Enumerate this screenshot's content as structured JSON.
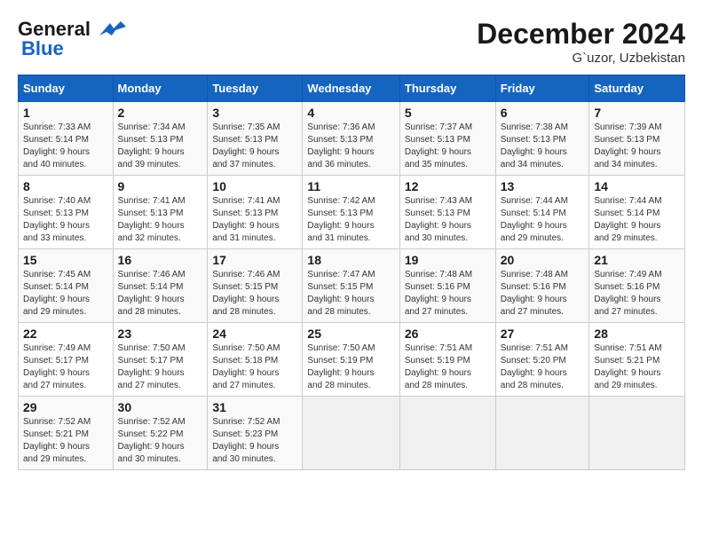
{
  "header": {
    "logo_line1": "General",
    "logo_line2": "Blue",
    "month_title": "December 2024",
    "subtitle": "G`uzor, Uzbekistan"
  },
  "weekdays": [
    "Sunday",
    "Monday",
    "Tuesday",
    "Wednesday",
    "Thursday",
    "Friday",
    "Saturday"
  ],
  "weeks": [
    [
      {
        "day": "1",
        "info": "Sunrise: 7:33 AM\nSunset: 5:14 PM\nDaylight: 9 hours\nand 40 minutes."
      },
      {
        "day": "2",
        "info": "Sunrise: 7:34 AM\nSunset: 5:13 PM\nDaylight: 9 hours\nand 39 minutes."
      },
      {
        "day": "3",
        "info": "Sunrise: 7:35 AM\nSunset: 5:13 PM\nDaylight: 9 hours\nand 37 minutes."
      },
      {
        "day": "4",
        "info": "Sunrise: 7:36 AM\nSunset: 5:13 PM\nDaylight: 9 hours\nand 36 minutes."
      },
      {
        "day": "5",
        "info": "Sunrise: 7:37 AM\nSunset: 5:13 PM\nDaylight: 9 hours\nand 35 minutes."
      },
      {
        "day": "6",
        "info": "Sunrise: 7:38 AM\nSunset: 5:13 PM\nDaylight: 9 hours\nand 34 minutes."
      },
      {
        "day": "7",
        "info": "Sunrise: 7:39 AM\nSunset: 5:13 PM\nDaylight: 9 hours\nand 34 minutes."
      }
    ],
    [
      {
        "day": "8",
        "info": "Sunrise: 7:40 AM\nSunset: 5:13 PM\nDaylight: 9 hours\nand 33 minutes."
      },
      {
        "day": "9",
        "info": "Sunrise: 7:41 AM\nSunset: 5:13 PM\nDaylight: 9 hours\nand 32 minutes."
      },
      {
        "day": "10",
        "info": "Sunrise: 7:41 AM\nSunset: 5:13 PM\nDaylight: 9 hours\nand 31 minutes."
      },
      {
        "day": "11",
        "info": "Sunrise: 7:42 AM\nSunset: 5:13 PM\nDaylight: 9 hours\nand 31 minutes."
      },
      {
        "day": "12",
        "info": "Sunrise: 7:43 AM\nSunset: 5:13 PM\nDaylight: 9 hours\nand 30 minutes."
      },
      {
        "day": "13",
        "info": "Sunrise: 7:44 AM\nSunset: 5:14 PM\nDaylight: 9 hours\nand 29 minutes."
      },
      {
        "day": "14",
        "info": "Sunrise: 7:44 AM\nSunset: 5:14 PM\nDaylight: 9 hours\nand 29 minutes."
      }
    ],
    [
      {
        "day": "15",
        "info": "Sunrise: 7:45 AM\nSunset: 5:14 PM\nDaylight: 9 hours\nand 29 minutes."
      },
      {
        "day": "16",
        "info": "Sunrise: 7:46 AM\nSunset: 5:14 PM\nDaylight: 9 hours\nand 28 minutes."
      },
      {
        "day": "17",
        "info": "Sunrise: 7:46 AM\nSunset: 5:15 PM\nDaylight: 9 hours\nand 28 minutes."
      },
      {
        "day": "18",
        "info": "Sunrise: 7:47 AM\nSunset: 5:15 PM\nDaylight: 9 hours\nand 28 minutes."
      },
      {
        "day": "19",
        "info": "Sunrise: 7:48 AM\nSunset: 5:16 PM\nDaylight: 9 hours\nand 27 minutes."
      },
      {
        "day": "20",
        "info": "Sunrise: 7:48 AM\nSunset: 5:16 PM\nDaylight: 9 hours\nand 27 minutes."
      },
      {
        "day": "21",
        "info": "Sunrise: 7:49 AM\nSunset: 5:16 PM\nDaylight: 9 hours\nand 27 minutes."
      }
    ],
    [
      {
        "day": "22",
        "info": "Sunrise: 7:49 AM\nSunset: 5:17 PM\nDaylight: 9 hours\nand 27 minutes."
      },
      {
        "day": "23",
        "info": "Sunrise: 7:50 AM\nSunset: 5:17 PM\nDaylight: 9 hours\nand 27 minutes."
      },
      {
        "day": "24",
        "info": "Sunrise: 7:50 AM\nSunset: 5:18 PM\nDaylight: 9 hours\nand 27 minutes."
      },
      {
        "day": "25",
        "info": "Sunrise: 7:50 AM\nSunset: 5:19 PM\nDaylight: 9 hours\nand 28 minutes."
      },
      {
        "day": "26",
        "info": "Sunrise: 7:51 AM\nSunset: 5:19 PM\nDaylight: 9 hours\nand 28 minutes."
      },
      {
        "day": "27",
        "info": "Sunrise: 7:51 AM\nSunset: 5:20 PM\nDaylight: 9 hours\nand 28 minutes."
      },
      {
        "day": "28",
        "info": "Sunrise: 7:51 AM\nSunset: 5:21 PM\nDaylight: 9 hours\nand 29 minutes."
      }
    ],
    [
      {
        "day": "29",
        "info": "Sunrise: 7:52 AM\nSunset: 5:21 PM\nDaylight: 9 hours\nand 29 minutes."
      },
      {
        "day": "30",
        "info": "Sunrise: 7:52 AM\nSunset: 5:22 PM\nDaylight: 9 hours\nand 30 minutes."
      },
      {
        "day": "31",
        "info": "Sunrise: 7:52 AM\nSunset: 5:23 PM\nDaylight: 9 hours\nand 30 minutes."
      },
      {
        "day": "",
        "info": ""
      },
      {
        "day": "",
        "info": ""
      },
      {
        "day": "",
        "info": ""
      },
      {
        "day": "",
        "info": ""
      }
    ]
  ]
}
